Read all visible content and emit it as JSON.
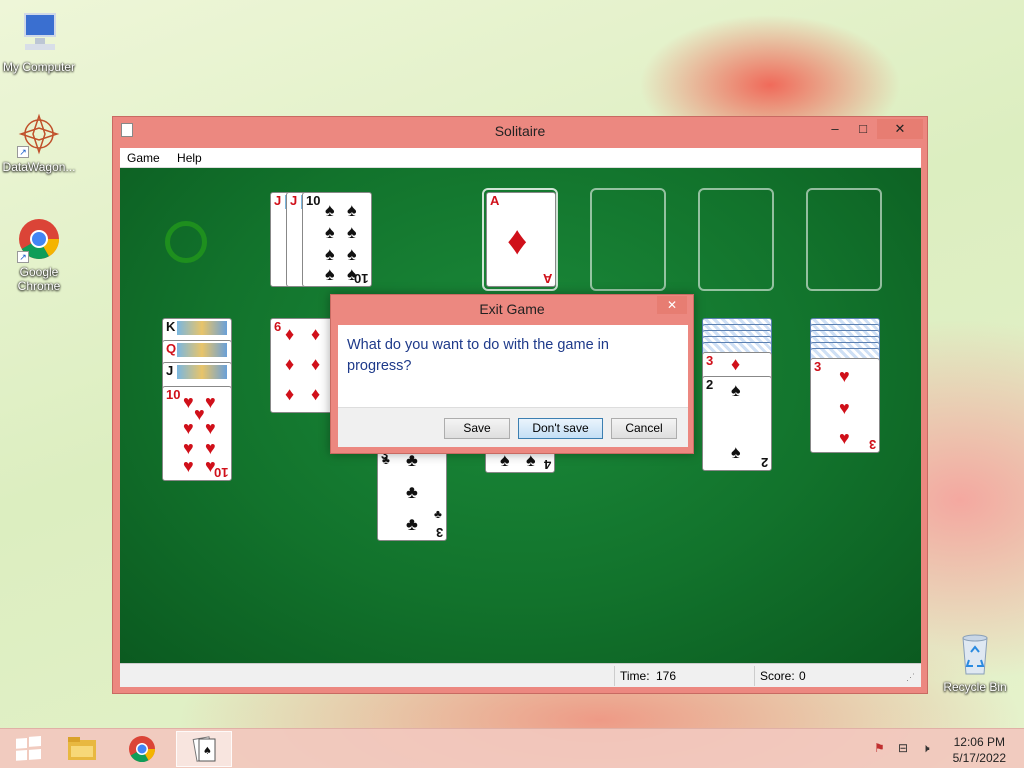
{
  "desktop": {
    "icons": [
      {
        "label": "My Computer"
      },
      {
        "label": "DataWagon..."
      },
      {
        "label": "Google Chrome"
      },
      {
        "label": "Recycle Bin"
      }
    ]
  },
  "window": {
    "title": "Solitaire",
    "minimize": "‒",
    "maximize": "□",
    "close": "✕",
    "menu": [
      "Game",
      "Help"
    ]
  },
  "status": {
    "time_label": "Time:",
    "time_value": "176",
    "score_label": "Score:",
    "score_value": "0"
  },
  "cards": {
    "waste": [
      {
        "rank": "J",
        "suit": "♥"
      },
      {
        "rank": "J",
        "suit": "♥"
      },
      {
        "rank": "10",
        "suit": "♠"
      }
    ],
    "foundation": [
      {
        "rank": "A",
        "suit": "♦"
      }
    ],
    "tableau1": [
      {
        "rank": "K",
        "suit": "♣"
      },
      {
        "rank": "Q",
        "suit": "♦"
      },
      {
        "rank": "J",
        "suit": "♣"
      },
      {
        "rank": "10",
        "suit": "♥"
      }
    ],
    "tableau2": [
      {
        "rank": "6",
        "suit": "♦"
      }
    ],
    "tableau3": [
      {
        "rank": "3",
        "suit": "♣"
      }
    ],
    "tableau4": [
      {
        "rank": "4",
        "suit": "♠"
      }
    ],
    "tableau6": [
      {
        "rank": "3",
        "suit": "♦"
      },
      {
        "rank": "2",
        "suit": "♠"
      }
    ],
    "tableau7": [
      {
        "rank": "3",
        "suit": "♥"
      }
    ]
  },
  "dialog": {
    "title": "Exit Game",
    "close": "✕",
    "message": "What do you want to do with the game in progress?",
    "buttons": {
      "save": "Save",
      "dont_save": "Don't save",
      "cancel": "Cancel"
    }
  },
  "taskbar": {
    "time": "12:06 PM",
    "date": "5/17/2022"
  },
  "icons": {
    "start": "windows-logo",
    "explorer": "folder",
    "chrome": "chrome",
    "solitaire": "cards"
  }
}
